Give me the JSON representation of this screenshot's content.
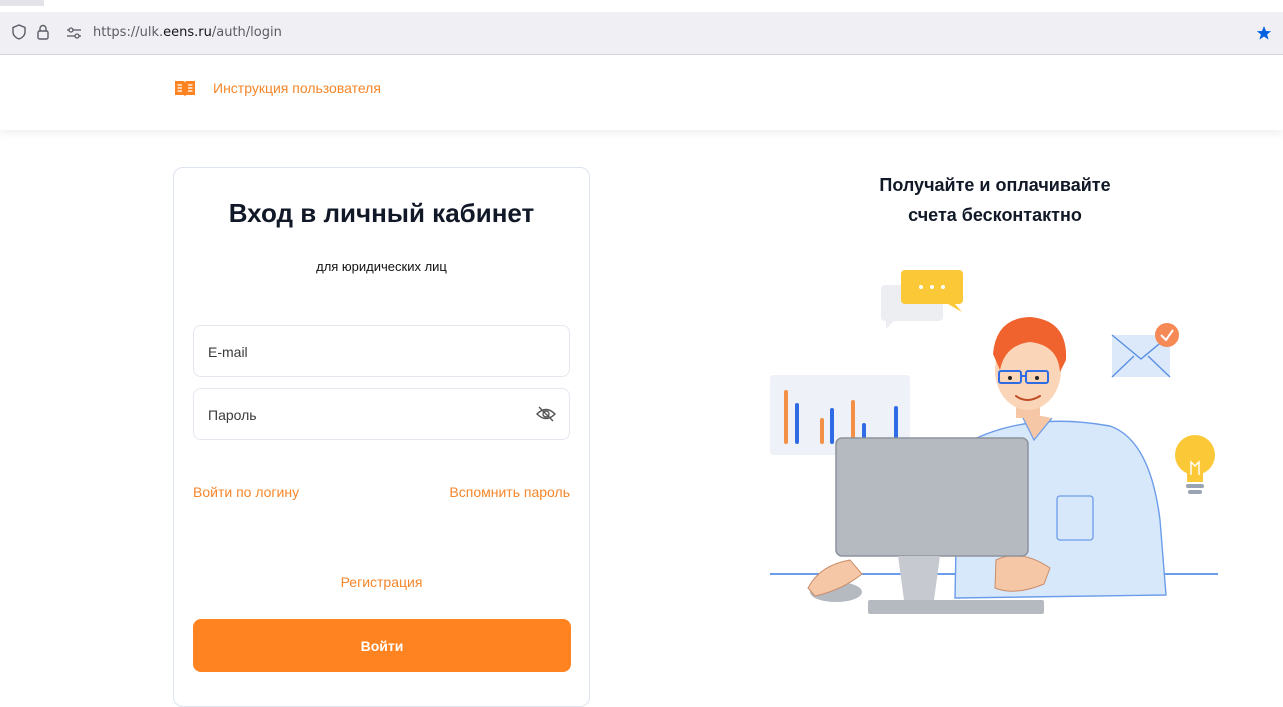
{
  "browser": {
    "url_prefix": "https://ulk.",
    "url_host": "eens.ru",
    "url_path": "/auth/login"
  },
  "header": {
    "instruction_link": "Инструкция пользователя"
  },
  "login": {
    "title": "Вход в личный кабинет",
    "subtitle": "для юридических лиц",
    "email_placeholder": "E-mail",
    "password_placeholder": "Пароль",
    "login_by_username": "Войти по логину",
    "forgot_password": "Вспомнить пароль",
    "register": "Регистрация",
    "submit": "Войти"
  },
  "promo": {
    "line1": "Получайте и оплачивайте",
    "line2": "счета бесконтактно"
  },
  "colors": {
    "accent": "#ff8321",
    "link": "#f5862a",
    "title": "#111827"
  }
}
